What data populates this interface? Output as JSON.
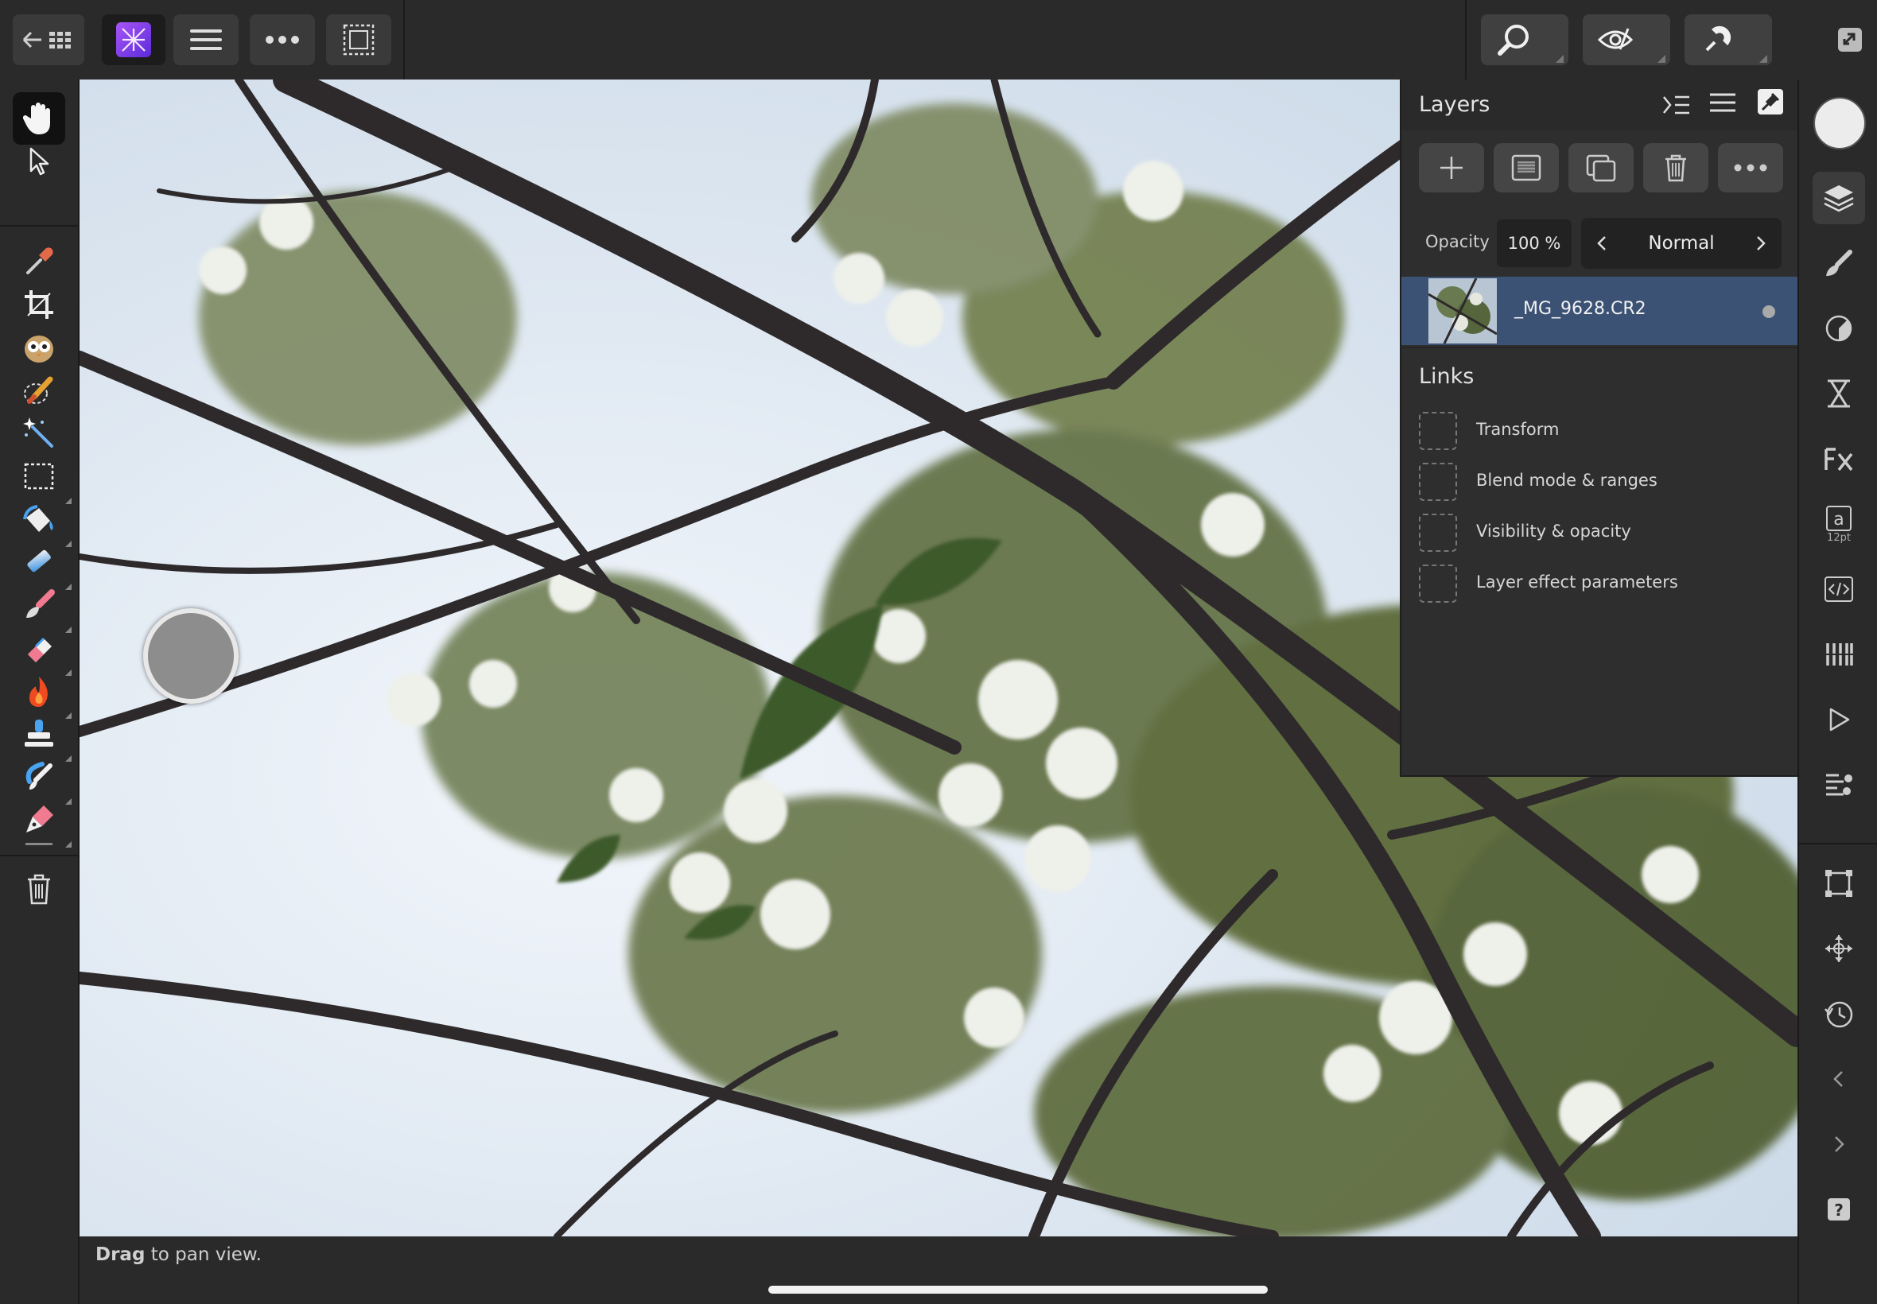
{
  "toolbar": {
    "brand_color": "#7b3cff"
  },
  "status": {
    "hint_bold": "Drag",
    "hint_rest": " to pan view."
  },
  "layers_panel": {
    "title": "Layers",
    "opacity_label": "Opacity",
    "opacity_value": "100 %",
    "blend_mode": "Normal",
    "layers": [
      {
        "name": "_MG_9628.CR2",
        "selected": true
      }
    ],
    "links_title": "Links",
    "links": [
      {
        "label": "Transform"
      },
      {
        "label": "Blend mode & ranges"
      },
      {
        "label": "Visibility & opacity"
      },
      {
        "label": "Layer effect parameters"
      }
    ]
  },
  "studio": {
    "text_size_label": "12pt"
  },
  "colors": {
    "selection": "#3b5274",
    "panel": "#2e2e2e",
    "toolbar": "#2a2a2a"
  }
}
